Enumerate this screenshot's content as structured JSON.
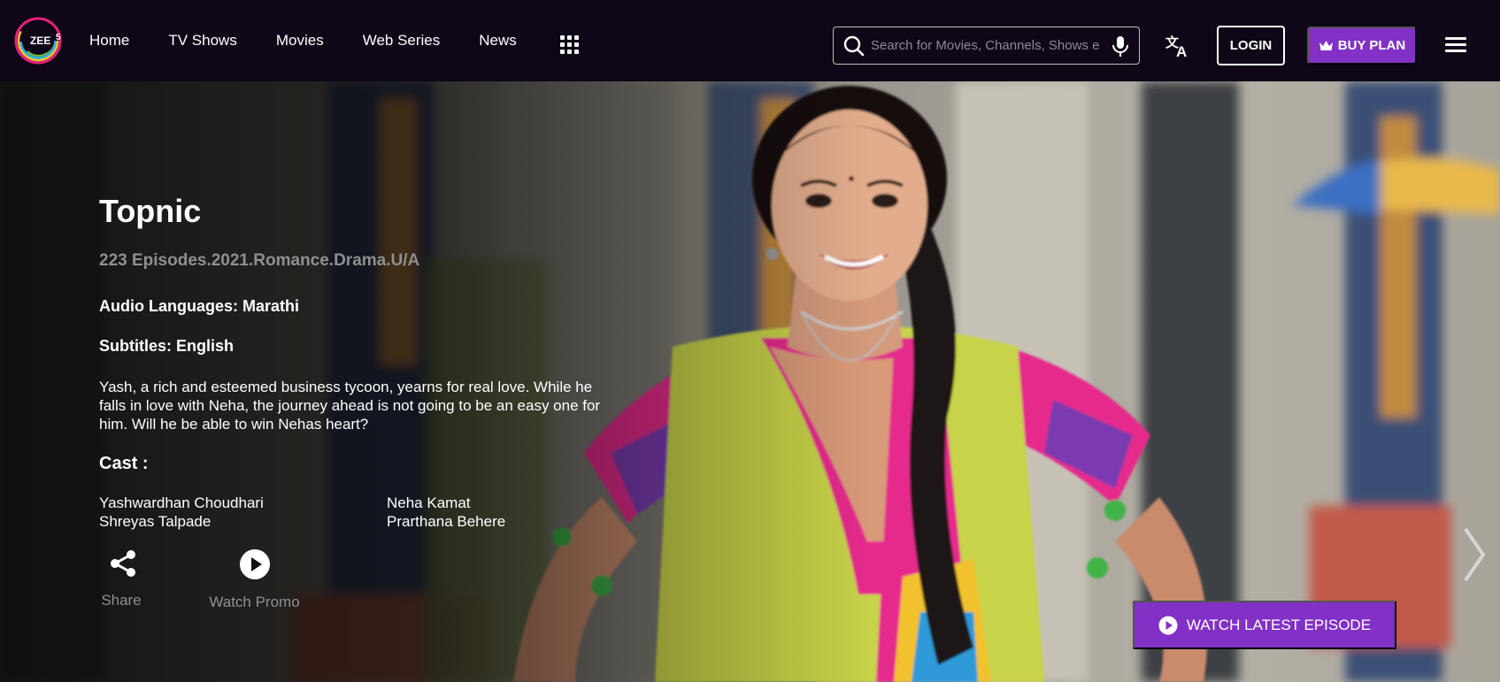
{
  "brand": {
    "logo_text": "ZEE",
    "logo_sup": "5"
  },
  "nav": {
    "items": [
      "Home",
      "TV Shows",
      "Movies",
      "Web Series",
      "News"
    ]
  },
  "search": {
    "placeholder": "Search for Movies, Channels, Shows e"
  },
  "header": {
    "login_label": "LOGIN",
    "buy_plan_label": "BUY PLAN"
  },
  "show": {
    "title": "Topnic",
    "meta": "223 Episodes.2021.Romance.Drama.U/A",
    "audio_languages": "Audio Languages: Marathi",
    "subtitles": "Subtitles: English",
    "description": "Yash, a rich and esteemed business tycoon, yearns for real love. While he falls in love with Neha, the journey ahead is not going to be an easy one for him. Will he be able to win Nehas heart?",
    "cast_heading": "Cast :",
    "cast": [
      "Yashwardhan Choudhari",
      "Neha Kamat",
      "Shreyas Talpade",
      "Prarthana Behere"
    ]
  },
  "actions": {
    "share_label": "Share",
    "promo_label": "Watch Promo"
  },
  "cta": {
    "watch_latest_label": "WATCH LATEST EPISODE"
  },
  "colors": {
    "brand_purple": "#8230c6",
    "header_bg": "#0f0617"
  },
  "icons": [
    "zee5-logo",
    "apps-grid-icon",
    "search-icon",
    "mic-icon",
    "translate-icon",
    "crown-icon",
    "hamburger-icon",
    "share-icon",
    "play-icon",
    "chevron-right-icon"
  ]
}
